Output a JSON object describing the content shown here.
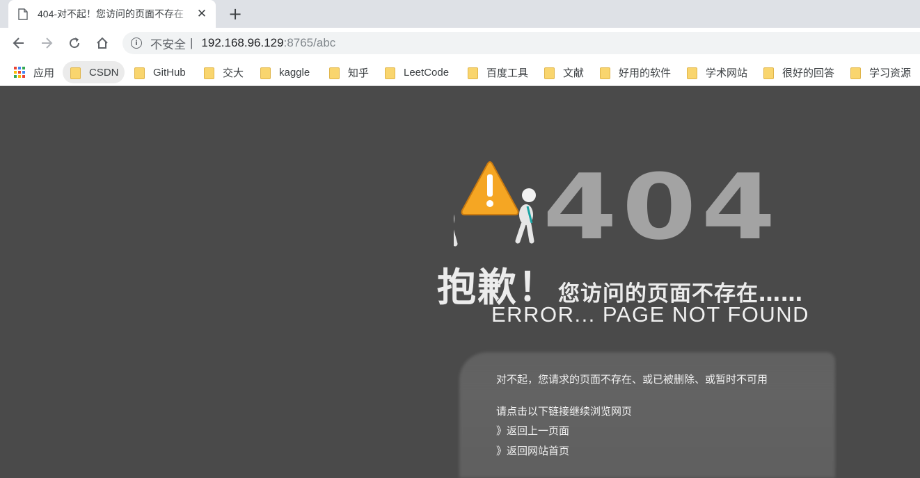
{
  "tab": {
    "title": "404-对不起！您访问的页面不存在",
    "close_label": "✕",
    "new_tab_label": "+"
  },
  "omnibox": {
    "info_glyph": "i",
    "security": "不安全",
    "separator": "|",
    "host": "192.168.96.129",
    "path": ":8765/abc"
  },
  "bookmarks": [
    {
      "label": "应用",
      "icon": "apps-grid-icon"
    },
    {
      "label": "CSDN",
      "icon": "folder-icon"
    },
    {
      "label": "GitHub",
      "icon": "folder-icon"
    },
    {
      "label": "交大",
      "icon": "folder-icon"
    },
    {
      "label": "kaggle",
      "icon": "folder-icon"
    },
    {
      "label": "知乎",
      "icon": "folder-icon"
    },
    {
      "label": "LeetCode",
      "icon": "folder-icon"
    },
    {
      "label": "百度工具",
      "icon": "folder-icon"
    },
    {
      "label": "文献",
      "icon": "folder-icon"
    },
    {
      "label": "好用的软件",
      "icon": "folder-icon"
    },
    {
      "label": "学术网站",
      "icon": "folder-icon"
    },
    {
      "label": "很好的回答",
      "icon": "folder-icon"
    },
    {
      "label": "学习资源",
      "icon": "folder-icon"
    }
  ],
  "page": {
    "code": "404",
    "sorry_big": "抱歉！",
    "sorry_small": "您访问的页面不存在……",
    "error_text": "ERROR... PAGE NOT FOUND",
    "message": "对不起，您请求的页面不存在、或已被删除、或暂时不可用",
    "prompt": "请点击以下链接继续浏览网页",
    "link_back": "》返回上一页面",
    "link_home": "》返回网站首页"
  },
  "colors": {
    "page_bg": "#4a4a4a",
    "warning_orange": "#f5a623",
    "digits": "#a3a3a3"
  }
}
